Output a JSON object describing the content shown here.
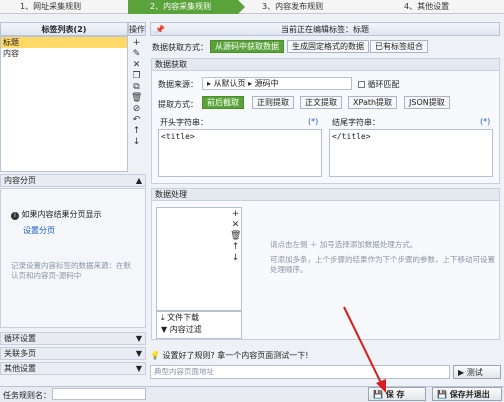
{
  "steps": [
    "1、网址采集规则",
    "2、内容采集规则",
    "3、内容发布规则",
    "4、其他设置"
  ],
  "tag_list": {
    "title": "标签列表(2)",
    "items": [
      "标题",
      "内容"
    ],
    "toolbar_title": "操作"
  },
  "left_sections": {
    "paging": "内容分页",
    "paging_hint": "如果内容结果分页显示",
    "paging_link": "设置分页",
    "record_hint": "记录设置内容标签的数据来源：在默认页和内容页-源码中",
    "loop": "循环设置",
    "related": "关联多页",
    "other": "其他设置"
  },
  "editing": {
    "label": "当前正在编辑标签：",
    "tag": "标题"
  },
  "data_method": {
    "label": "数据获取方式：",
    "tabs": [
      "从源码中获取数据",
      "生成固定格式的数据",
      "已有标签组合"
    ]
  },
  "data_fetch": {
    "title": "数据获取",
    "source_label": "数据来源：",
    "source_path": [
      "从默认页",
      "源码中"
    ],
    "loop_match": "循环匹配",
    "extract_label": "提取方式：",
    "extract_tabs": [
      "前后截取",
      "正则提取",
      "正文提取",
      "XPath提取",
      "JSON提取"
    ],
    "start_label": "开头字符串：",
    "end_label": "结尾字符串：",
    "star": "(*)",
    "start_value": "<title>",
    "end_value": "</title>"
  },
  "processing": {
    "title": "数据处理",
    "hint1": "请点击左侧 ＋ 加号选择添加数据处理方式。",
    "hint2": "可添加多条，上个步骤的结果作为下个步骤的参数，上下移动可设置处理顺序。",
    "items": [
      "文件下载",
      "内容过滤"
    ]
  },
  "test": {
    "text": "设置好了规则? 拿一个内容页面测试一下!",
    "placeholder": "典型内容页面地址",
    "button": "测试"
  },
  "footer": {
    "task_label": "任务规则名：",
    "save": "保 存",
    "save_exit": "保存并退出"
  }
}
